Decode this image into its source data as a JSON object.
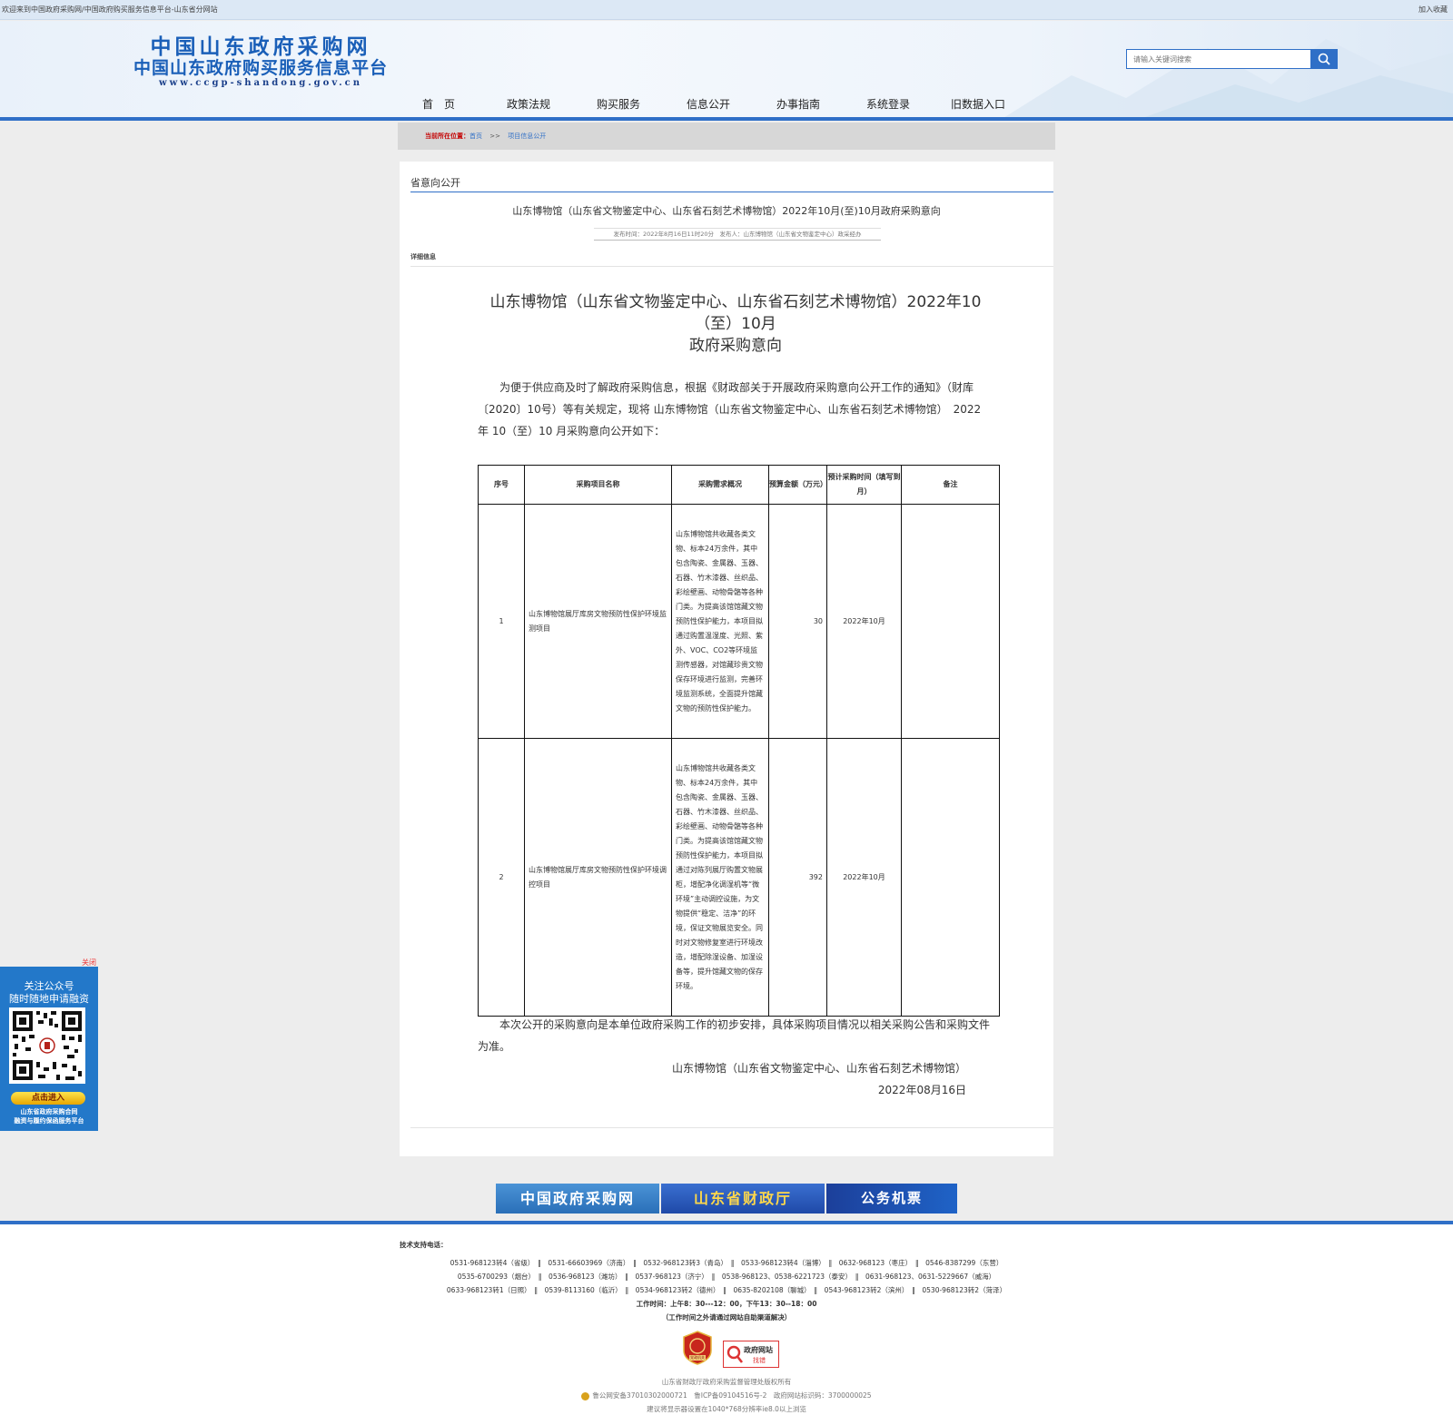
{
  "topbar": {
    "welcome": "欢迎来到中国政府采购网/中国政府购买服务信息平台-山东省分网站",
    "favorite": "加入收藏"
  },
  "logo": {
    "line1": "中国山东政府采购网",
    "line2": "中国山东政府购买服务信息平台",
    "line3": "www.ccgp-shandong.gov.cn"
  },
  "search": {
    "placeholder": "请输入关键词搜索"
  },
  "nav": [
    "首　页",
    "政策法规",
    "购买服务",
    "信息公开",
    "办事指南",
    "系统登录",
    "旧数据入口"
  ],
  "breadcrumb": {
    "label": "当前所在位置：",
    "home": "首页",
    "sep": ">>",
    "current": "项目信息公开"
  },
  "panel": {
    "section": "省意向公开",
    "title": "山东博物馆（山东省文物鉴定中心、山东省石刻艺术博物馆）2022年10月(至)10月政府采购意向",
    "meta": "发布时间：2022年8月16日11时20分　发布人：山东博物馆（山东省文物鉴定中心）政采经办",
    "detail_label": "详细信息"
  },
  "doc": {
    "title_line1": "山东博物馆（山东省文物鉴定中心、山东省石刻艺术博物馆）2022年10",
    "title_line2": "（至）10月",
    "title_line3": "政府采购意向",
    "intro": "为便于供应商及时了解政府采购信息，根据《财政部关于开展政府采购意向公开工作的通知》（财库〔2020〕10号）等有关规定，现将 山东博物馆（山东省文物鉴定中心、山东省石刻艺术博物馆）　2022年 10（至）10 月采购意向公开如下：",
    "headers": [
      "序号",
      "采购项目名称",
      "采购需求概况",
      "预算金额（万元）",
      "预计采购时间（填写到月）",
      "备注"
    ],
    "rows": [
      {
        "no": "1",
        "name": "山东博物馆展厅库房文物预防性保护环境监测项目",
        "desc": "山东博物馆共收藏各类文物、标本24万余件，其中包含陶瓷、金属器、玉器、石器、竹木漆器、丝织品、彩绘壁画、动物骨骼等各种门类。为提高该馆馆藏文物预防性保护能力，本项目拟通过购置温湿度、光照、紫外、VOC、CO2等环境监测传感器，对馆藏珍贵文物保存环境进行监测，完善环境监测系统，全面提升馆藏文物的预防性保护能力。",
        "budget": "30",
        "time": "2022年10月",
        "note": ""
      },
      {
        "no": "2",
        "name": "山东博物馆展厅库房文物预防性保护环境调控项目",
        "desc": "山东博物馆共收藏各类文物、标本24万余件，其中包含陶瓷、金属器、玉器、石器、竹木漆器、丝织品、彩绘壁画、动物骨骼等各种门类。为提高该馆馆藏文物预防性保护能力，本项目拟通过对陈列展厅购置文物展柜，增配净化调湿机等“微环境”主动调控设施，为文物提供“稳定、洁净”的环境，保证文物展览安全。同时对文物修复室进行环境改造，增配除湿设备、加湿设备等，提升馆藏文物的保存环境。",
        "budget": "392",
        "time": "2022年10月",
        "note": ""
      }
    ],
    "closing": "本次公开的采购意向是本单位政府采购工作的初步安排，具体采购项目情况以相关采购公告和采购文件为准。",
    "sign_org": "山东博物馆（山东省文物鉴定中心、山东省石刻艺术博物馆）",
    "sign_date": "2022年08月16日"
  },
  "banners": [
    "中国政府采购网",
    "山东省财政厅",
    "公务机票"
  ],
  "footer": {
    "tech_label": "技术支持电话：",
    "line1": "0531-968123转4（省级）　‖　0531-66603969（济南）　‖　0532-968123转3（青岛）　‖　0533-968123转4（淄博）　‖　0632-968123（枣庄）　‖　0546-8387299（东营）",
    "line2": "0535-6700293（烟台）　‖　0536-968123（潍坊）　‖　0537-968123（济宁）　‖　0538-968123、0538-6221723（泰安）　‖　0631-968123、0631-5229667（威海）",
    "line3": "0633-968123转1（日照）　‖　0539-8113160（临沂）　‖　0534-968123转2（德州）　‖　0635-8202108（聊城）　‖　0543-968123转2（滨州）　‖　0530-968123转2（菏泽）",
    "hours": "工作时间：上午8：30---12：00，下午13：30--18：00",
    "hours_note": "（工作时间之外请通过网站自助渠道解决）",
    "badge1": "党政机关",
    "badge2a": "政府网站",
    "badge2b": "找错",
    "copyright": "山东省财政厅政府采购监督管理处版权所有",
    "icp": "鲁公网安备37010302000721　鲁ICP备09104516号-2　政府网站标识码：3700000025",
    "browser": "建议将显示器设置在1040*768分辨率ie8.0以上浏览"
  },
  "side": {
    "close": "关闭",
    "line1": "关注公众号",
    "line2": "随时随地申请融资",
    "button": "点击进入",
    "foot1": "山东省政府采购合同",
    "foot2": "融资与履约保函服务平台"
  },
  "colors": {
    "accent": "#2f6fc7",
    "logo": "#1a5fb8"
  }
}
